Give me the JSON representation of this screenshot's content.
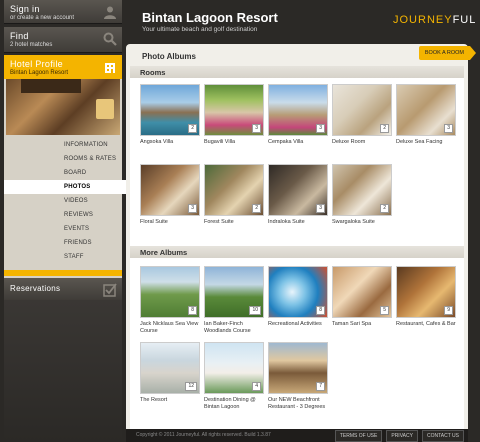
{
  "sidebar": {
    "signin": {
      "title": "Sign in",
      "sub": "or create a new account"
    },
    "find": {
      "title": "Find",
      "sub": "2 hotel matches"
    },
    "profile": {
      "title": "Hotel Profile",
      "sub": "Bintan Lagoon Resort"
    },
    "nav": [
      "INFORMATION",
      "ROOMS & RATES",
      "BOARD",
      "PHOTOS",
      "VIDEOS",
      "REVIEWS",
      "EVENTS",
      "FRIENDS",
      "STAFF"
    ],
    "active_nav": "PHOTOS",
    "reservations": "Reservations"
  },
  "header": {
    "title": "Bintan Lagoon Resort",
    "subtitle": "Your ultimate beach and golf destination",
    "logo_part1": "JOURNEY",
    "logo_part2": "FUL"
  },
  "main": {
    "panel_title": "Photo Albums",
    "book_button": "BOOK A ROOM",
    "rooms": {
      "heading": "Rooms",
      "albums": [
        {
          "caption": "Angsoka Villa",
          "count": "2",
          "bg": "linear-gradient(#6fa7d9 0%, #a9cde8 35%, #8a7052 55%, #3f8ea8 75%, #2a6d86 100%)"
        },
        {
          "caption": "Bugavili Villa",
          "count": "3",
          "bg": "linear-gradient(#5f8f3a 0%, #9fc160 30%, #d8c6a8 55%, #c94a7a 80%, #6e8e3e 100%)"
        },
        {
          "caption": "Cempaka Villa",
          "count": "3",
          "bg": "linear-gradient(#7fb0e0 0%, #c9dcea 35%, #b79c76 60%, #c4467a 85%, #5c8a3c 100%)"
        },
        {
          "caption": "Deluxe Room",
          "count": "2",
          "bg": "linear-gradient(135deg, #e9e4da 0%, #d8cdb8 40%, #b9a27e 70%, #f2efe8 100%)"
        },
        {
          "caption": "Deluxe Sea Facing",
          "count": "3",
          "bg": "linear-gradient(135deg, #d9cbb2 0%, #b89a70 45%, #e8dfd0 75%, #a88a60 100%)"
        },
        {
          "caption": "Floral Suite",
          "count": "3",
          "bg": "linear-gradient(135deg, #5a3e28 0%, #a97f55 40%, #e6d7bd 65%, #7a5a3a 100%)"
        },
        {
          "caption": "Forest Suite",
          "count": "2",
          "bg": "linear-gradient(135deg, #4d6a3a 0%, #a0875e 40%, #e4d3b0 65%, #6b4e33 100%)"
        },
        {
          "caption": "Indraloka Suite",
          "count": "3",
          "bg": "linear-gradient(135deg, #2f2a26 0%, #6a5a48 40%, #c9b9a0 70%, #3a3028 100%)"
        },
        {
          "caption": "Swargaloka Suite",
          "count": "2",
          "bg": "linear-gradient(135deg, #cfc3ad 0%, #a88c66 35%, #eee6d8 65%, #8a7050 100%)"
        }
      ]
    },
    "more": {
      "heading": "More Albums",
      "albums": [
        {
          "caption": "Jack Nicklaus Sea View Course",
          "count": "8",
          "bg": "linear-gradient(#a9c8e0 0%, #cfdfe8 30%, #6f9a4a 55%, #4f7d34 100%)"
        },
        {
          "caption": "Ian Baker-Finch Woodlands Course",
          "count": "10",
          "bg": "linear-gradient(#8fb4d8 0%, #c4d8e6 35%, #5a8a3a 60%, #3f6e28 100%)"
        },
        {
          "caption": "Recreational Activities",
          "count": "8",
          "bg": "radial-gradient(circle at 40% 50%, #e8f4fb 0%, #7ec3e6 30%, #1f7fbf 60%, #d05030 100%)"
        },
        {
          "caption": "Taman Sari Spa",
          "count": "5",
          "bg": "linear-gradient(135deg, #c89a6a 0%, #f0d8b8 40%, #9a6a40 70%, #e2c49a 100%)"
        },
        {
          "caption": "Restaurant, Cafes & Bar",
          "count": "9",
          "bg": "linear-gradient(135deg, #5a3a20 0%, #b0743a 40%, #e6b870 65%, #7a4a28 100%)"
        },
        {
          "caption": "The Resort",
          "count": "12",
          "bg": "linear-gradient(#e6eef4 0%, #c9d6de 35%, #d8d4cc 60%, #a8b0a8 100%)"
        },
        {
          "caption": "Destination Dining @ Bintan Lagoon",
          "count": "4",
          "bg": "linear-gradient(#cfe4f2 0%, #e8f0f4 40%, #f2eee8 60%, #6a9a5a 100%)"
        },
        {
          "caption": "Our NEW Beachfront Restaurant - 3 Degrees",
          "count": "7",
          "bg": "linear-gradient(#9fb8d0 0%, #e0c8a0 35%, #7a5a3a 60%, #c8a878 100%)"
        }
      ]
    }
  },
  "footer": {
    "copyright": "Copyright © 2011 Journeyful. All rights reserved. Build 1.3.87",
    "links": [
      "TERMS OF USE",
      "PRIVACY",
      "CONTACT US"
    ]
  },
  "colors": {
    "accent": "#f4b400",
    "background": "#2b2926",
    "panel": "#f1efe9"
  },
  "icons": {
    "signin": "person-icon",
    "find": "search-icon",
    "profile": "hotel-icon",
    "reservations": "checkbox-icon"
  }
}
